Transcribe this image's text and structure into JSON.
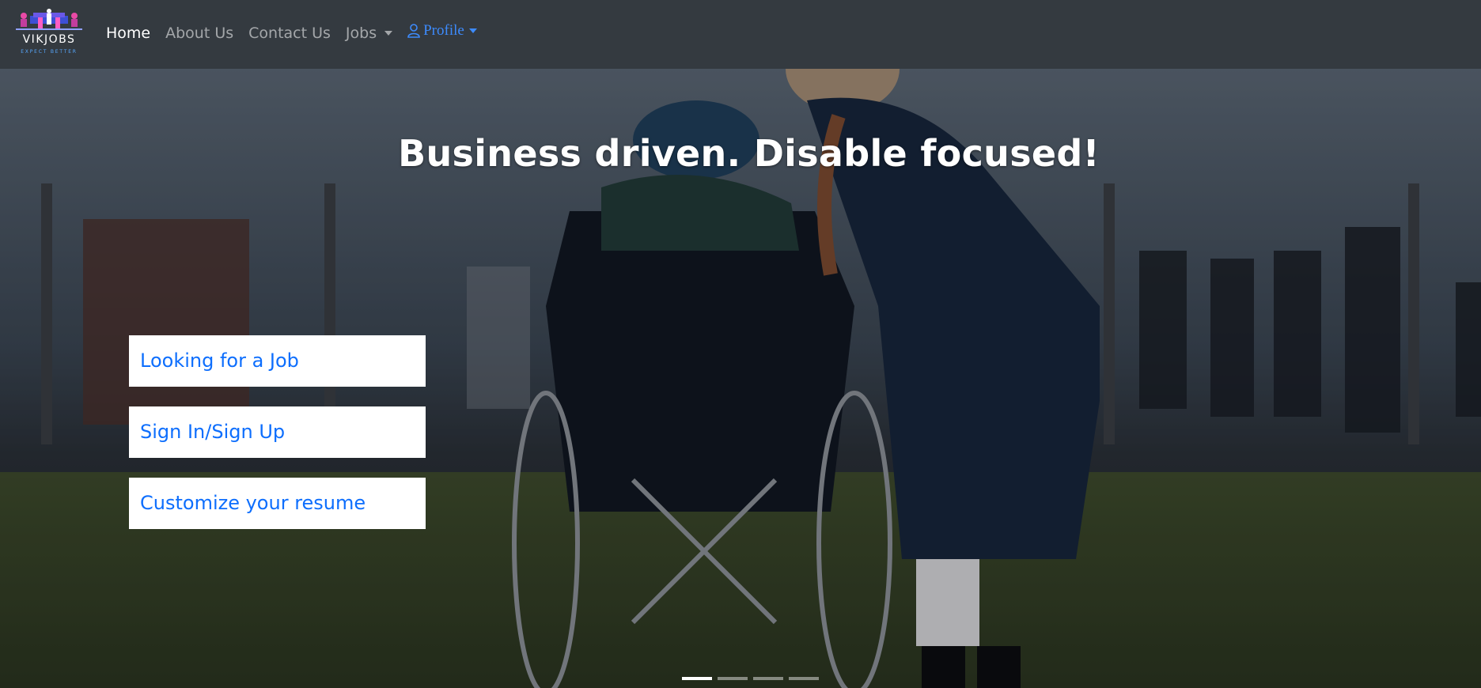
{
  "brand": {
    "name": "VIKJOBS",
    "tagline": "EXPECT BETTER"
  },
  "nav": {
    "items": [
      {
        "label": "Home",
        "active": true
      },
      {
        "label": "About Us",
        "active": false
      },
      {
        "label": "Contact Us",
        "active": false
      },
      {
        "label": "Jobs",
        "active": false,
        "dropdown": true
      }
    ],
    "profile": {
      "label": "Profile",
      "icon": "user-icon",
      "dropdown": true
    }
  },
  "hero": {
    "headline": "Business driven. Disable focused!",
    "actions": [
      {
        "label": "Looking for a Job"
      },
      {
        "label": "Sign In/Sign Up"
      },
      {
        "label": "Customize your resume"
      }
    ],
    "carousel": {
      "slide_count": 4,
      "active_slide": 1
    }
  },
  "colors": {
    "navbar_bg": "#343a40",
    "link_primary": "#0d6efd",
    "profile_link": "#3d8bfd",
    "nav_active": "#ffffff",
    "nav_inactive": "rgba(255,255,255,0.55)"
  }
}
